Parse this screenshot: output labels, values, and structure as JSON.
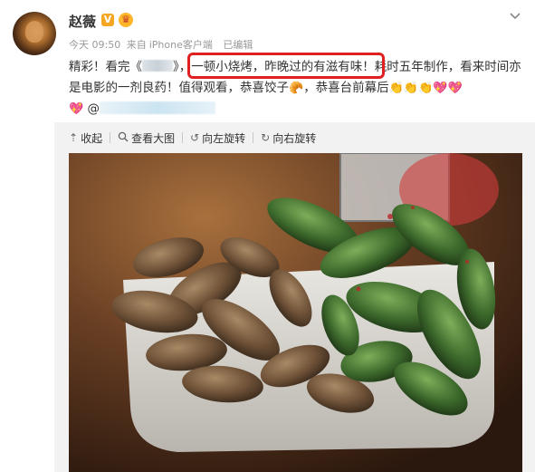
{
  "user": {
    "name": "赵薇",
    "verified_badge": "V",
    "avatar_icon": "avatar"
  },
  "meta": {
    "time": "今天 09:50",
    "source_prefix": "来自",
    "device": "iPhone客户端",
    "edited": "已编辑"
  },
  "post": {
    "text_part1": "精彩！看完《",
    "text_part2": "》，",
    "highlighted": "一顿小烧烤，昨晚过的有滋有味！",
    "text_part3": "耗时五年制作，看来时间亦是电影的一剂良药！值得观看，恭喜饺子",
    "text_part4": "，恭喜台前幕后",
    "mention_prefix": "@"
  },
  "toolbar": {
    "collapse": "收起",
    "view_large": "查看大图",
    "rotate_left": "向左旋转",
    "rotate_right": "向右旋转"
  },
  "icons": {
    "collapse": "arrow-up-icon",
    "view_large": "magnifier-icon",
    "rotate_left": "rotate-left-icon",
    "rotate_right": "rotate-right-icon",
    "dropdown": "chevron-down-icon"
  },
  "colors": {
    "highlight_border": "#e02020",
    "toolbar_bg": "#f2f2f2",
    "badge": "#f5a623"
  }
}
